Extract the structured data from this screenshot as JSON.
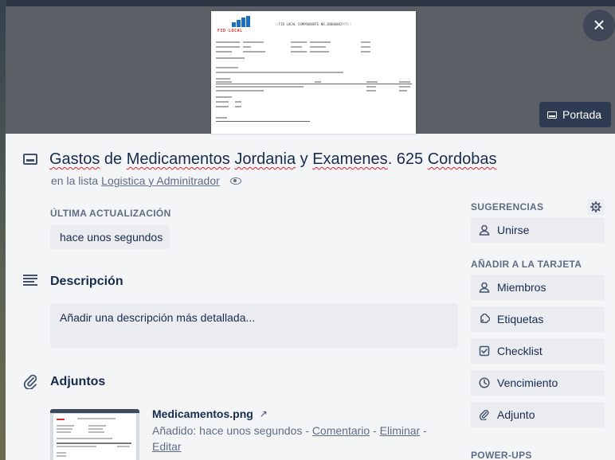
{
  "cover": {
    "heading": "::FID LOCAL COMPROBANTE NO.2B000002???::",
    "logo_text": "FID LOCAL",
    "cover_button_label": "Portada",
    "close_label": "×"
  },
  "card": {
    "title_parts": [
      "Gastos",
      " de ",
      "Medicamentos",
      " ",
      "Jordania",
      " y ",
      "Examenes",
      ". 625 ",
      "Cordobas"
    ],
    "in_list_prefix": "en la lista",
    "list_name": "Logistica y Admin­itrador"
  },
  "last_update": {
    "label": "ÚLTIMA ACTUALIZACIÓN",
    "value": "hace unos segundos"
  },
  "description": {
    "title": "Descripción",
    "placeholder": "Añadir una descripción más detallada..."
  },
  "attachments": {
    "title": "Adjuntos",
    "file_name": "Medicamentos.png",
    "added_prefix": "Añadido: hace unos segundos - ",
    "comment_link": "Comentario",
    "separator": " - ",
    "delete_link": "Eliminar",
    "edit_link": "Editar"
  },
  "sidebar": {
    "suggestions_label": "SUGERENCIAS",
    "join_button": "Unirse",
    "add_to_card_label": "AÑADIR A LA TARJETA",
    "buttons": [
      {
        "label": "Miembros",
        "icon": "member-icon"
      },
      {
        "label": "Etiquetas",
        "icon": "label-icon"
      },
      {
        "label": "Checklist",
        "icon": "checklist-icon"
      },
      {
        "label": "Vencimiento",
        "icon": "clock-icon"
      },
      {
        "label": "Adjunto",
        "icon": "paperclip-icon"
      }
    ],
    "powerups_label": "POWER-UPS"
  }
}
